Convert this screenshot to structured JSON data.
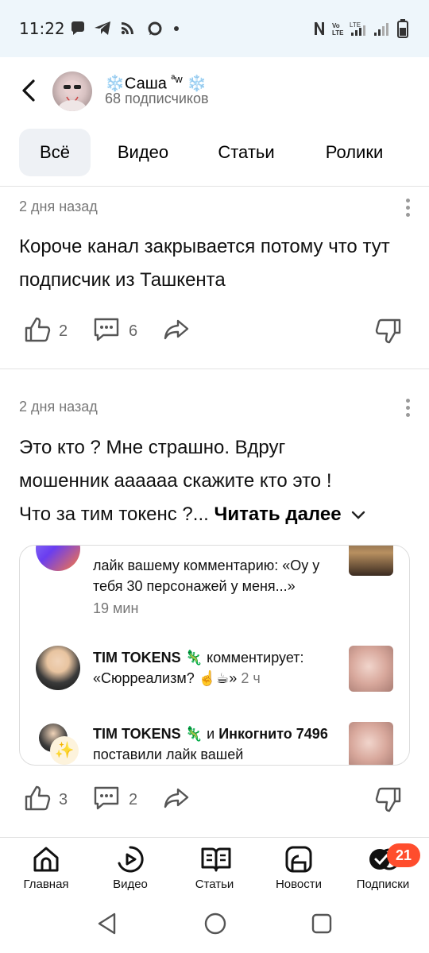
{
  "status_bar": {
    "time": "11:22",
    "icons": [
      "chat-bubble-icon",
      "telegram-icon",
      "rss-icon",
      "message-circle-icon",
      "dot-icon",
      "nfc-icon",
      "volte-icon",
      "lte-signal-icon",
      "signal-icon",
      "battery-icon"
    ],
    "volte": "Vo LTE"
  },
  "header": {
    "channel_name": "Саша",
    "name_suffix": "ªw",
    "decoration": "❄️",
    "subscribers": "68 подписчиков"
  },
  "tabs": [
    {
      "label": "Всё",
      "active": true
    },
    {
      "label": "Видео",
      "active": false
    },
    {
      "label": "Статьи",
      "active": false
    },
    {
      "label": "Ролики",
      "active": false
    }
  ],
  "posts": [
    {
      "date": "2 дня назад",
      "text": "Короче канал закрывается потому что тут подписчик из Ташкента",
      "likes": "2",
      "comments": "6"
    },
    {
      "date": "2 дня назад",
      "text_line1": "Это кто ? Мне страшно. Вдруг",
      "text_line2": "мошенник аааааа скажите кто это !",
      "text_line3": "Что за тим токенс ?...",
      "read_more": "Читать далее",
      "likes": "3",
      "comments": "2",
      "embed": {
        "notifications": [
          {
            "text": "лайк вашему комментарию: «Оу у тебя 30 персонажей у меня...»",
            "time": "19 мин"
          },
          {
            "user": "TIM TOKENS",
            "action": "комментирует:",
            "quote": "«Сюрреализм? ☝️☕»",
            "time": "2 ч"
          },
          {
            "user": "TIM TOKENS",
            "conj": "и",
            "user2": "Инкогнито 7496",
            "action": "поставили лайк вашей"
          }
        ]
      }
    }
  ],
  "bottom_nav": [
    {
      "label": "Главная",
      "icon": "home-icon"
    },
    {
      "label": "Видео",
      "icon": "video-play-icon"
    },
    {
      "label": "Статьи",
      "icon": "book-icon"
    },
    {
      "label": "Новости",
      "icon": "news-icon"
    },
    {
      "label": "Подписки",
      "icon": "subscriptions-icon",
      "badge": "21"
    }
  ],
  "colors": {
    "status_bg": "#eef6fb",
    "tab_active_bg": "#eef1f5",
    "badge": "#ff4d2d",
    "snowflake": "#4aa7e8"
  }
}
